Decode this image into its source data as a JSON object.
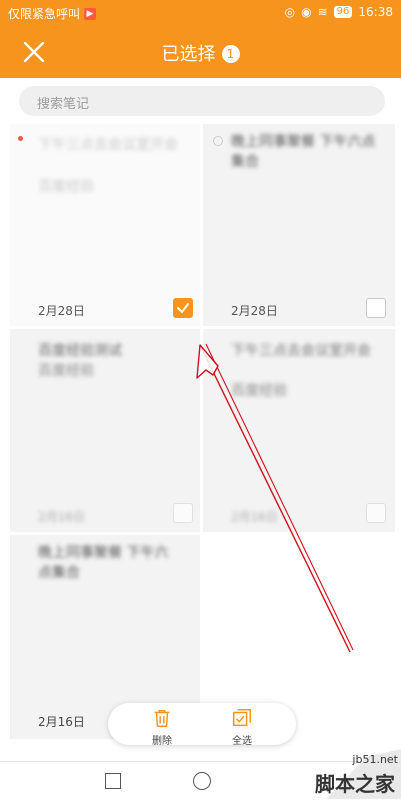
{
  "status_bar": {
    "left_text": "仅限紧急呼叫",
    "battery": "96",
    "time": "16:38"
  },
  "header": {
    "title": "已选择",
    "selected_count": "1"
  },
  "search": {
    "placeholder": "搜索笔记"
  },
  "notes": [
    {
      "title": "下午三点去会议室开会",
      "subtitle": "百度经验",
      "date": "2月28日",
      "checked": true
    },
    {
      "title": "晚上同事聚餐 下午六点集合",
      "subtitle": "",
      "date": "2月28日",
      "checked": false
    },
    {
      "title": "百度经验测试",
      "subtitle": "百度经验",
      "date": "2月16日",
      "checked": false
    },
    {
      "title": "下午三点去会议室开会",
      "subtitle": "百度经验",
      "date": "2月16日",
      "checked": false
    },
    {
      "title": "晚上同事聚餐 下午六点集合",
      "subtitle": "",
      "date": "2月16日",
      "checked": false
    }
  ],
  "actions": {
    "delete_label": "删除",
    "select_all_label": "全选"
  },
  "watermark": {
    "site": "jb51.net",
    "brand": "脚本之家"
  },
  "colors": {
    "accent": "#F7941D",
    "arrow": "#D0101B"
  }
}
